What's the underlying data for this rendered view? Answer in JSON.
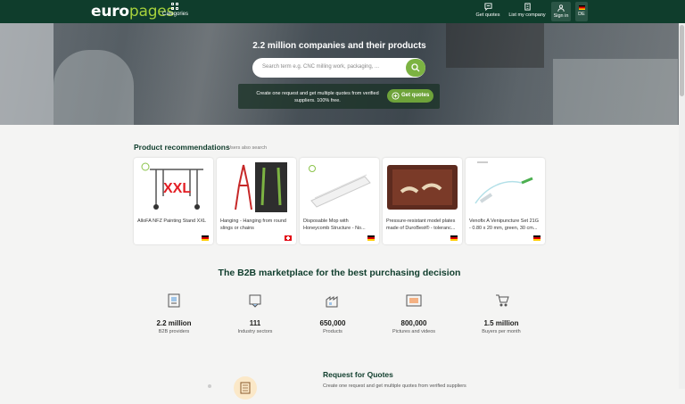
{
  "header": {
    "logo_prefix": "euro",
    "logo_suffix": "pages",
    "categories_label": "Categories",
    "get_quotes_label": "Get quotes",
    "list_company_label": "List my company",
    "sign_in_label": "Sign in",
    "language": "DE"
  },
  "hero": {
    "title": "2.2 million companies and their products",
    "search_placeholder": "Search term e.g. CNC milling work, packaging, ...",
    "quote_text": "Create one request and get multiple quotes from verified suppliers. 100% free.",
    "quote_button": "Get quotes"
  },
  "recommendations": {
    "title": "Product recommendations",
    "subtitle": "Users also search",
    "items": [
      {
        "caption": "AlloFA NFZ Painting Stand XXL",
        "country": "de",
        "image_text": "XXL"
      },
      {
        "caption": "Hanging - Hanging from round slings or chains",
        "country": "ch"
      },
      {
        "caption": "Disposable Mop with Honeycomb Structure - No...",
        "country": "de"
      },
      {
        "caption": "Pressure-resistant model plates made of DuroBest® - toleranc...",
        "country": "de"
      },
      {
        "caption": "Venofix A Venipuncture Set 21G - 0.80 x 20 mm, green, 30 cm...",
        "country": "de"
      }
    ]
  },
  "b2b": {
    "title": "The B2B marketplace for the best purchasing decision",
    "stats": [
      {
        "value": "2.2 million",
        "label": "B2B providers",
        "icon": "providers-icon"
      },
      {
        "value": "111",
        "label": "Industry sectors",
        "icon": "sectors-icon"
      },
      {
        "value": "650,000",
        "label": "Products",
        "icon": "products-icon"
      },
      {
        "value": "800,000",
        "label": "Pictures and videos",
        "icon": "pictures-icon"
      },
      {
        "value": "1.5 million",
        "label": "Buyers per month",
        "icon": "buyers-icon"
      }
    ]
  },
  "rfq": {
    "title": "Request for Quotes",
    "subtitle": "Create one request and get multiple quotes from verified suppliers"
  },
  "colors": {
    "header_bg": "#0f3d2c",
    "accent_green": "#7cb342",
    "logo_green": "#a6d13c"
  }
}
